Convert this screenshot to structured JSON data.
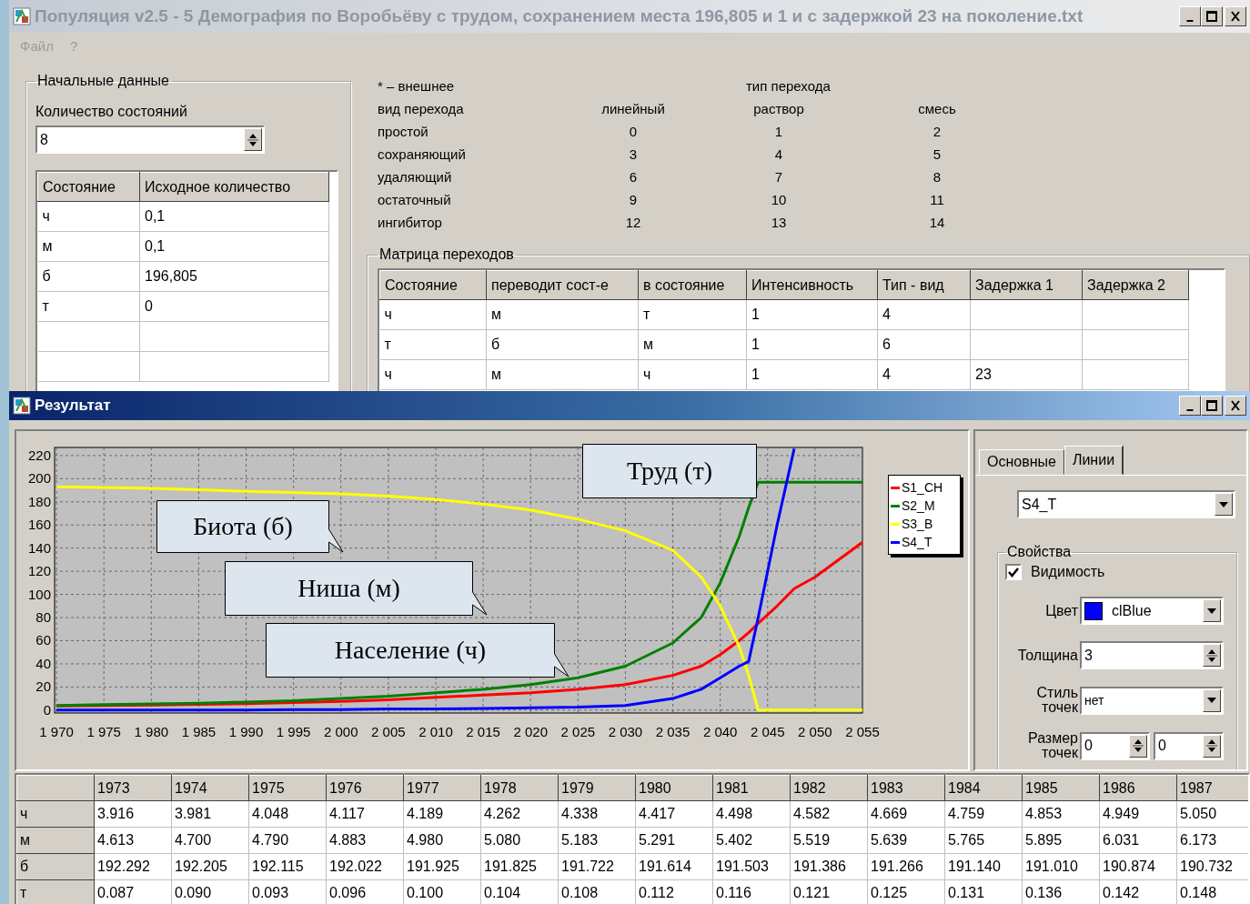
{
  "main_window": {
    "title": "Популяция v2.5 - 5 Демография по Воробьёву с трудом, сохранением места 196,805 и 1 и с задержкой 23 на поколение.txt",
    "active": false,
    "menu": [
      {
        "label": "Файл",
        "disabled": true
      },
      {
        "label": "?",
        "disabled": true
      }
    ],
    "initial_data": {
      "title": "Начальные данные",
      "count_label": "Количество состояний",
      "count_value": "8",
      "table": {
        "columns": [
          "Состояние",
          "Исходное количество"
        ],
        "rows": [
          [
            "ч",
            "0,1"
          ],
          [
            "м",
            "0,1"
          ],
          [
            "б",
            "196,805"
          ],
          [
            "т",
            "0"
          ]
        ]
      }
    },
    "transition_legend": {
      "note": "* – внешнее",
      "type_header": "тип перехода",
      "columns": [
        "вид перехода",
        "линейный",
        "раствор",
        "смесь"
      ],
      "rows": [
        [
          "простой",
          "0",
          "1",
          "2"
        ],
        [
          "сохраняющий",
          "3",
          "4",
          "5"
        ],
        [
          "удаляющий",
          "6",
          "7",
          "8"
        ],
        [
          "остаточный",
          "9",
          "10",
          "11"
        ],
        [
          "ингибитор",
          "12",
          "13",
          "14"
        ]
      ]
    },
    "transition_matrix": {
      "title": "Матрица переходов",
      "columns": [
        "Состояние",
        "переводит сост-е",
        "в состояние",
        "Интенсивность",
        "Тип - вид",
        "Задержка 1",
        "Задержка 2"
      ],
      "rows": [
        [
          "ч",
          "м",
          "т",
          "1",
          "4",
          "",
          ""
        ],
        [
          "т",
          "б",
          "м",
          "1",
          "6",
          "",
          ""
        ],
        [
          "ч",
          "м",
          "ч",
          "1",
          "4",
          "23",
          ""
        ]
      ]
    }
  },
  "result_window": {
    "title": "Результат",
    "active": true,
    "chart_data": {
      "type": "line",
      "grid": true,
      "xlim": [
        1969.8,
        2055
      ],
      "ylim": [
        -2.5,
        227
      ],
      "x": [
        1970,
        1975,
        1980,
        1985,
        1990,
        1995,
        2000,
        2005,
        2010,
        2015,
        2020,
        2025,
        2030,
        2035,
        2038,
        2040,
        2042,
        2043,
        2044,
        2046,
        2047.8,
        2050,
        2055
      ],
      "series": [
        {
          "name": "S1_CH",
          "color": "#ff0000",
          "values": [
            3.6,
            4,
            4.4,
            5,
            5.6,
            6.5,
            7.5,
            9,
            11,
            13,
            15,
            18,
            22,
            30,
            38,
            48,
            60,
            67,
            75,
            90,
            105,
            115,
            145
          ]
        },
        {
          "name": "S2_M",
          "color": "#008000",
          "values": [
            4,
            4.8,
            5.3,
            6,
            7,
            8,
            10,
            12,
            15,
            18,
            22,
            28,
            38,
            58,
            80,
            110,
            150,
            175,
            197,
            197,
            197,
            197,
            197
          ]
        },
        {
          "name": "S3_B",
          "color": "#ffff00",
          "values": [
            193,
            192.5,
            191.6,
            190.5,
            189,
            188,
            187,
            185,
            182,
            178,
            173,
            165,
            155,
            138,
            115,
            90,
            55,
            30,
            0,
            0,
            0,
            0,
            0
          ]
        },
        {
          "name": "S4_T",
          "color": "#0000ff",
          "values": [
            0,
            0,
            0,
            0,
            0,
            0.5,
            0.5,
            1,
            1,
            1.5,
            2,
            2.5,
            4,
            10,
            18,
            28,
            38,
            42,
            80,
            160,
            226,
            null,
            null
          ]
        }
      ],
      "yticks": [
        0,
        20,
        40,
        60,
        80,
        100,
        120,
        140,
        160,
        180,
        200,
        220
      ],
      "xticks": [
        {
          "value": 1970,
          "label": "1 970"
        },
        {
          "value": 1975,
          "label": "1 975"
        },
        {
          "value": 1980,
          "label": "1 980"
        },
        {
          "value": 1985,
          "label": "1 985"
        },
        {
          "value": 1990,
          "label": "1 990"
        },
        {
          "value": 1995,
          "label": "1 995"
        },
        {
          "value": 2000,
          "label": "2 000"
        },
        {
          "value": 2005,
          "label": "2 005"
        },
        {
          "value": 2010,
          "label": "2 010"
        },
        {
          "value": 2015,
          "label": "2 015"
        },
        {
          "value": 2020,
          "label": "2 020"
        },
        {
          "value": 2025,
          "label": "2 025"
        },
        {
          "value": 2030,
          "label": "2 030"
        },
        {
          "value": 2035,
          "label": "2 035"
        },
        {
          "value": 2040,
          "label": "2 040"
        },
        {
          "value": 2045,
          "label": "2 045"
        },
        {
          "value": 2050,
          "label": "2 050"
        },
        {
          "value": 2055,
          "label": "2 055"
        }
      ],
      "annotations": [
        {
          "text": "Труд (т)"
        },
        {
          "text": "Биота (б)"
        },
        {
          "text": "Ниша (м)"
        },
        {
          "text": "Население (ч)"
        }
      ]
    },
    "settings": {
      "tabs": [
        {
          "label": "Основные",
          "selected": false
        },
        {
          "label": "Линии",
          "selected": true
        }
      ],
      "series_select": "S4_T",
      "properties": {
        "title": "Свойства",
        "visible": {
          "label": "Видимость",
          "checked": true
        },
        "color": {
          "label": "Цвет",
          "color": "#0000ff",
          "value": "clBlue"
        },
        "width": {
          "label": "Толщина",
          "value": "3"
        },
        "point_style": {
          "label": "Стиль точек",
          "value": "нет"
        },
        "point_size": {
          "label": "Размер точек",
          "values": [
            "0",
            "0"
          ]
        }
      }
    },
    "data_table": {
      "columns": [
        "1973",
        "1974",
        "1975",
        "1976",
        "1977",
        "1978",
        "1979",
        "1980",
        "1981",
        "1982",
        "1983",
        "1984",
        "1985",
        "1986",
        "1987"
      ],
      "rows": [
        {
          "label": "ч",
          "values": [
            "3.916",
            "3.981",
            "4.048",
            "4.117",
            "4.189",
            "4.262",
            "4.338",
            "4.417",
            "4.498",
            "4.582",
            "4.669",
            "4.759",
            "4.853",
            "4.949",
            "5.050"
          ]
        },
        {
          "label": "м",
          "values": [
            "4.613",
            "4.700",
            "4.790",
            "4.883",
            "4.980",
            "5.080",
            "5.183",
            "5.291",
            "5.402",
            "5.519",
            "5.639",
            "5.765",
            "5.895",
            "6.031",
            "6.173"
          ]
        },
        {
          "label": "б",
          "values": [
            "192.292",
            "192.205",
            "192.115",
            "192.022",
            "191.925",
            "191.825",
            "191.722",
            "191.614",
            "191.503",
            "191.386",
            "191.266",
            "191.140",
            "191.010",
            "190.874",
            "190.732"
          ]
        },
        {
          "label": "т",
          "values": [
            "0.087",
            "0.090",
            "0.093",
            "0.096",
            "0.100",
            "0.104",
            "0.108",
            "0.112",
            "0.116",
            "0.121",
            "0.125",
            "0.131",
            "0.136",
            "0.142",
            "0.148"
          ]
        }
      ]
    }
  }
}
